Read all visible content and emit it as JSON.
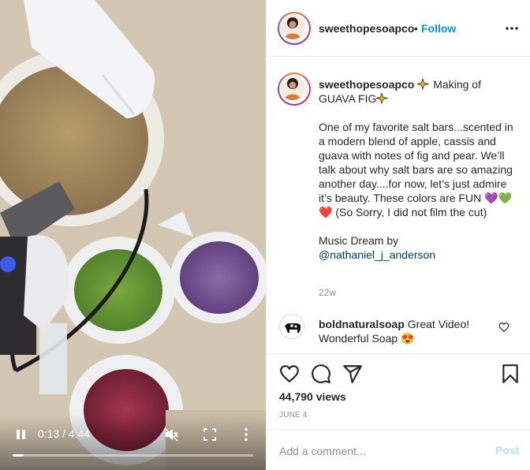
{
  "video": {
    "time": "0:13 / 4:44",
    "progress": 0.046,
    "icons": [
      "pause-icon",
      "muted-speaker-icon",
      "fullscreen-icon",
      "more-vertical-icon"
    ]
  },
  "post": {
    "username": "sweethopesoapco",
    "follow_label": "Follow",
    "dot": "•",
    "caption_title": " Making of GUAVA FIG",
    "caption_body": "One of my favorite salt bars...scented in a modern blend of apple, cassis and guava with notes of fig and pear. We’ll talk about why salt bars are so amazing another day....for now, let’s just admire it’s beauty. These colors are FUN 💜💚❤️ (So Sorry, I did not film the cut)",
    "music_line": "Music Dream by",
    "mention": "@nathaniel_j_anderson",
    "age": "22w",
    "views": "44,790 views",
    "date": "JUNE 4"
  },
  "comment": {
    "username": "boldnaturalsoap",
    "text": " Great Video! Wonderful Soap 😍"
  },
  "add_comment": {
    "placeholder": "Add a comment...",
    "post_label": "Post"
  },
  "colors": {
    "accent": "#0095f6",
    "post_disabled": "#b2dffc",
    "muted_text": "#8e8e8e",
    "border": "#efefef"
  }
}
